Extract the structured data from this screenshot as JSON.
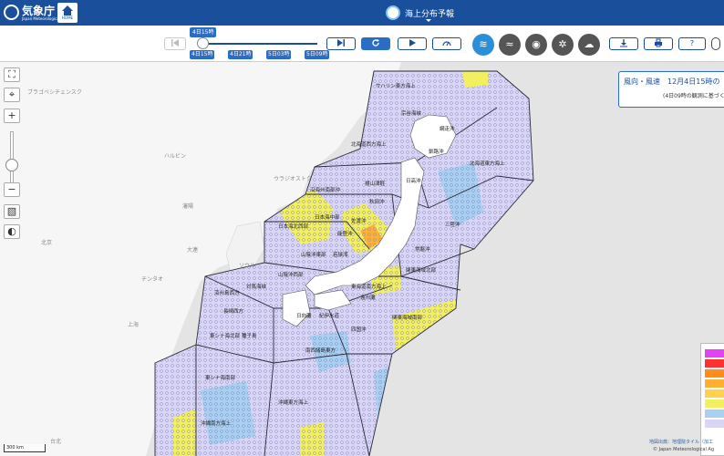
{
  "header": {
    "agency_name": "気象庁",
    "agency_sub": "Japan Meteorological Agency",
    "home_label": "HOME",
    "page_title": "海上分布予報"
  },
  "timeline": {
    "current_time": "4日15時",
    "ticks": [
      "4日15時",
      "4日21時",
      "5日03時",
      "5日09時"
    ]
  },
  "toolbar": {
    "first_icon": "skip-back-icon",
    "last_icon": "skip-forward-icon",
    "reload_icon": "reload-icon",
    "play_icon": "play-icon",
    "speed_icon": "gauge-icon",
    "element_icons": [
      "wind-icon",
      "wave-icon",
      "visibility-icon",
      "sea-ice-icon",
      "weather-icon"
    ],
    "download_icon": "download-icon",
    "print_icon": "print-icon",
    "help_label": "?"
  },
  "info": {
    "title": "風向・風速　12月4日15時の",
    "subtitle": "(4日09時の観測に基づく"
  },
  "map_labels": {
    "countries": [
      "ブラゴベシチェンスク",
      "ハルビン",
      "ウラジオストク",
      "瀋陽",
      "北京",
      "大連",
      "ソウル",
      "チンタオ",
      "上海",
      "台北"
    ],
    "sea_areas": [
      "サハリン東方海上",
      "宗谷海峡",
      "網走沖",
      "北海道西方海上",
      "釧路沖",
      "北海道東方海上",
      "日高沖",
      "檜山津軽",
      "沿海州南部沖",
      "秋田沖",
      "日本海北西部",
      "日本海中部",
      "三陸沖",
      "佐渡沖",
      "能登沖",
      "常磐沖",
      "山陰沖東部",
      "若狭湾",
      "山陰沖西部",
      "関東海域北部",
      "対馬海峡",
      "済州島西方",
      "遠州灘",
      "東海道南方海上",
      "紀伊水道",
      "日向灘",
      "関東海域南部",
      "長崎西方",
      "東シナ海北部",
      "四国沖",
      "沖縄東方海上",
      "種子島",
      "南西諸島東方",
      "東シナ海南部",
      "沖縄南方海上"
    ]
  },
  "scale": {
    "label": "300 km"
  },
  "credits": {
    "tiles": "地図出典：地理院タイル（加工",
    "copyright": "© Japan Meteorological Ag"
  },
  "legend": {
    "colors": [
      "#e442f5",
      "#ff3030",
      "#ff8c1a",
      "#ffb030",
      "#ffd24d",
      "#f3f060",
      "#a8d0f0",
      "#d9d6f5"
    ]
  },
  "colors": {
    "header": "#1a4f9c",
    "accent": "#2b6cc4",
    "calm": "#d9d6f5",
    "moderate": "#a8d0f0",
    "strong": "#f3f060",
    "very_strong": "#ffd24d",
    "gale": "#ffb030"
  }
}
